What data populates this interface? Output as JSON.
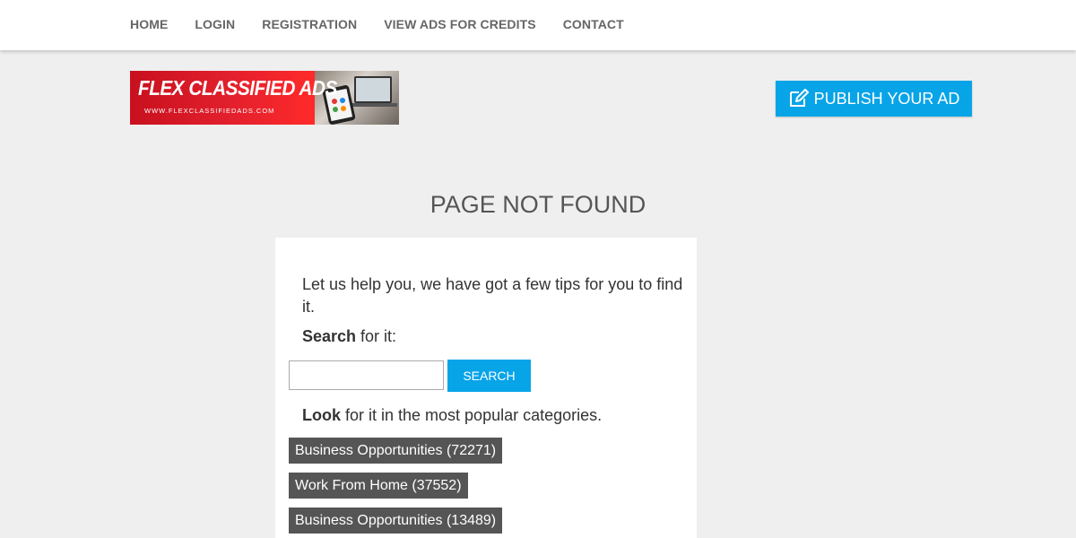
{
  "nav": {
    "items": [
      {
        "label": "HOME"
      },
      {
        "label": "LOGIN"
      },
      {
        "label": "REGISTRATION"
      },
      {
        "label": "VIEW ADS FOR CREDITS"
      },
      {
        "label": "CONTACT"
      }
    ]
  },
  "logo": {
    "title": "FLEX CLASSIFIED ADS",
    "url": "WWW.FLEXCLASSIFIEDADS.COM"
  },
  "header": {
    "publish_label": "PUBLISH YOUR AD",
    "publish_icon": "edit-icon"
  },
  "main": {
    "title": "PAGE NOT FOUND",
    "tips_text": "Let us help you, we have got a few tips for you to find it.",
    "search_bold": "Search",
    "search_rest": " for it:",
    "search_input_value": "",
    "search_button": "SEARCH",
    "look_bold": "Look",
    "look_rest": " for it in the most popular categories.",
    "categories": [
      {
        "label": "Business Opportunities (72271)"
      },
      {
        "label": "Work From Home (37552)"
      },
      {
        "label": "Business Opportunities (13489)"
      }
    ]
  },
  "colors": {
    "accent": "#08a4e8",
    "background": "#efefef",
    "category_bg": "#555555",
    "logo_red": "#e3202d"
  }
}
